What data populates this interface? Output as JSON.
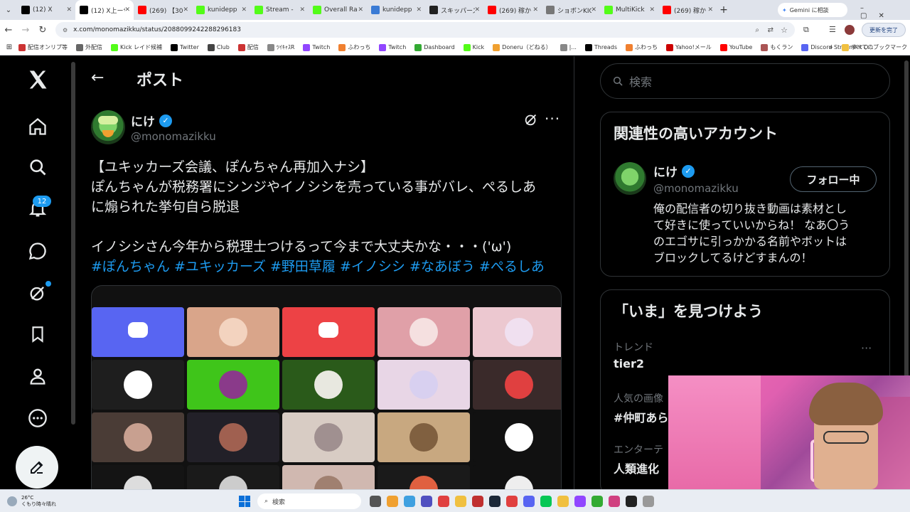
{
  "browser": {
    "tabs": [
      {
        "label": "(12) X",
        "icon": "x-icon",
        "color": "#000000",
        "active": false
      },
      {
        "label": "(12) X上ーザ",
        "icon": "x-icon",
        "color": "#000000",
        "active": true
      },
      {
        "label": "(269) 【30",
        "icon": "youtube-icon",
        "color": "#ff0000",
        "active": false
      },
      {
        "label": "kunidepp",
        "icon": "kick-icon",
        "color": "#53fc18",
        "active": false
      },
      {
        "label": "Stream -",
        "icon": "kick-icon",
        "color": "#53fc18",
        "active": false
      },
      {
        "label": "Overall Ra",
        "icon": "kick-icon",
        "color": "#53fc18",
        "active": false
      },
      {
        "label": "kunidepp",
        "icon": "link-icon",
        "color": "#3a7bd5",
        "active": false
      },
      {
        "label": "スキッパーズ",
        "icon": "skip-icon",
        "color": "#222222",
        "active": false
      },
      {
        "label": "(269) 稼か",
        "icon": "youtube-icon",
        "color": "#ff0000",
        "active": false
      },
      {
        "label": "ショボンKICK",
        "icon": "face-icon",
        "color": "#777777",
        "active": false
      },
      {
        "label": "MultiKick",
        "icon": "kick-icon",
        "color": "#53fc18",
        "active": false
      },
      {
        "label": "(269) 稼か",
        "icon": "youtube-icon",
        "color": "#ff0000",
        "active": false
      }
    ],
    "new_tab": "+",
    "gemini": "Gemini に相談",
    "url": "x.com/monomazikku/status/2088099242288296183",
    "update_btn": "更新を完了",
    "bookmarks": [
      "配信オンリプ等",
      "外配信",
      "Kick レイド候補",
      "Twitter",
      "Club",
      "配信",
      "ﾂｲｷｬｽR",
      "Twitch",
      "ふわっち",
      "Twitch",
      "Dashboard",
      "Kick",
      "Doneru（どねる）",
      "|...",
      "Threads",
      "ふわっち",
      "Yahoo!メール",
      "YouTube",
      "もくラン",
      "Discord StreamKit O..."
    ],
    "all_bookmarks": "すべてのブックマーク"
  },
  "nav": {
    "notification_count": "12"
  },
  "post": {
    "header_title": "ポスト",
    "author_name": "にけ",
    "author_handle": "@monomazikku",
    "line1": "【ユキッカーズ会議、ぽんちゃん再加入ナシ】",
    "line2": "ぽんちゃんが税務署にシンジやイノシシを売っている事がバレ、ぺるしあ",
    "line3": "に煽られた挙句自ら脱退",
    "line4": "イノシシさん今年から税理士つけるって今まで大丈夫かな・・・('ω')",
    "hashtags": [
      "#ぽんちゃん",
      "#ユキッカーズ",
      "#野田草履",
      "#イノシシ",
      "#なあぼう",
      "#ぺるしあ"
    ]
  },
  "sidebar": {
    "search_placeholder": "検索",
    "related_title": "関連性の高いアカウント",
    "account_name": "にけ",
    "account_handle": "@monomazikku",
    "follow_btn": "フォロー中",
    "bio": [
      "俺の配信者の切り抜き動画は素材とし",
      "て好きに使っていいからね！ なあ〇う",
      "のエゴサに引っかかる名前やボットは",
      "ブロックしてるけどすまんの！"
    ],
    "now_title": "「いま」を見つけよう",
    "trend1_label": "トレンド",
    "trend1_value": "tier2",
    "trend2_label": "人気の画像",
    "trend2_value": "#仲町あら",
    "trend3_label": "エンターテ",
    "trend3_value": "人類進化"
  },
  "taskbar": {
    "weather_temp": "26°C",
    "weather_desc": "くもり時々晴れ",
    "search": "検索"
  },
  "colors": {
    "accent": "#1d9bf0",
    "discord": "#5865f2",
    "discord_red": "#ed4245"
  }
}
